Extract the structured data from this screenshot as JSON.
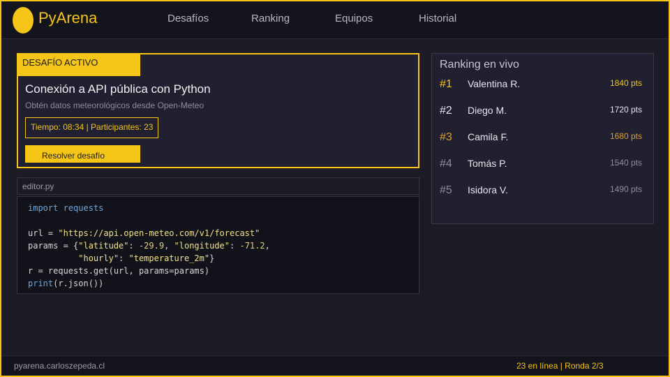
{
  "app": {
    "name": "PyArena"
  },
  "nav": [
    {
      "label": "Desafíos"
    },
    {
      "label": "Ranking"
    },
    {
      "label": "Equipos"
    },
    {
      "label": "Historial"
    }
  ],
  "challenge": {
    "tag": "DESAFÍO ACTIVO",
    "title": "Conexión a API pública con Python",
    "subtitle": "Obtén datos meteorológicos desde Open-Meteo",
    "meta": "Tiempo: 08:34  |  Participantes: 23",
    "button_label": "Resolver desafío"
  },
  "editor": {
    "filename": "editor.py",
    "code": [
      "import requests",
      "",
      "url = \"https://api.open-meteo.com/v1/forecast\"",
      "params = {\"latitude\": -29.9, \"longitude\": -71.2,",
      "          \"hourly\": \"temperature_2m\"}",
      "r = requests.get(url, params=params)",
      "print(r.json())"
    ]
  },
  "ranking": {
    "title": "Ranking en vivo",
    "entries": [
      {
        "pos": "#1",
        "name": "Valentina R.",
        "points": "1840 pts",
        "color": "#f5c518"
      },
      {
        "pos": "#2",
        "name": "Diego M.",
        "points": "1720 pts",
        "color": "#e6e6ea"
      },
      {
        "pos": "#3",
        "name": "Camila F.",
        "points": "1680 pts",
        "color": "#e0a030"
      },
      {
        "pos": "#4",
        "name": "Tomás P.",
        "points": "1540 pts",
        "color": "#8d8d9a"
      },
      {
        "pos": "#5",
        "name": "Isidora V.",
        "points": "1490 pts",
        "color": "#8d8d9a"
      }
    ]
  },
  "footer": {
    "site": "pyarena.carloszepeda.cl",
    "status": "23 en línea  |  Ronda 2/3"
  },
  "colors": {
    "accent": "#f5c518",
    "background": "#1c1c26",
    "panel": "#202030"
  }
}
